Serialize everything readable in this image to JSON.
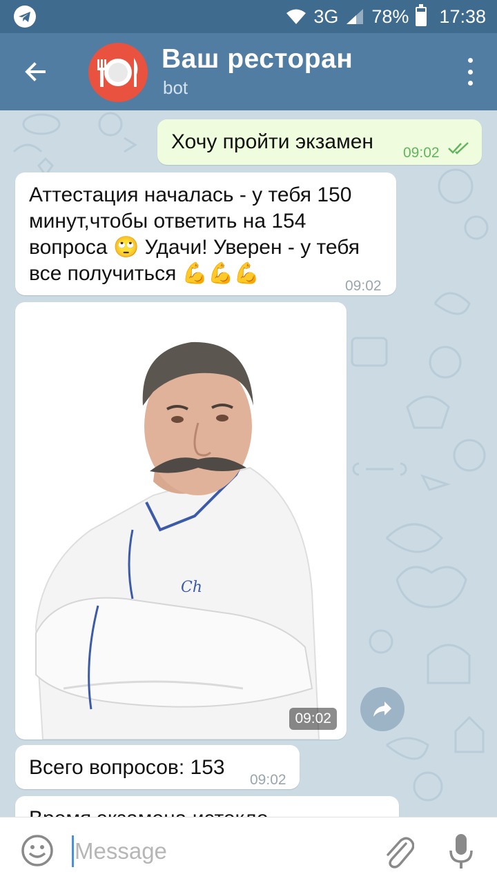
{
  "status_bar": {
    "network": "3G",
    "battery": "78%",
    "battery_level": 0.78,
    "time": "17:38",
    "icons": [
      "telegram-icon",
      "wifi-icon",
      "signal-icon",
      "battery-icon"
    ]
  },
  "header": {
    "title": "Ваш ресторан",
    "subtitle": "bot",
    "avatar_icon": "plate-cutlery-icon",
    "avatar_color": "#e8523f",
    "back_icon": "back-arrow-icon",
    "menu_icon": "more-vert-icon"
  },
  "messages": {
    "m1": {
      "text": "Хочу пройти экзамен",
      "time": "09:02",
      "status_icon": "double-check-icon"
    },
    "m2": {
      "line1": "Аттестация началась - у тебя 150",
      "line2": "минут,чтобы ответить на 154",
      "line3a": "вопроса",
      "emoji_rolling": "🙄",
      "line3b": "Удачи! Уверен - у тебя",
      "line4": "все получиться",
      "emoji_muscles": "💪💪💪",
      "time": "09:02"
    },
    "m3": {
      "type": "photo",
      "time": "09:02",
      "share_icon": "share-icon"
    },
    "m4": {
      "text": "Всего вопросов: 153",
      "time": "09:02"
    },
    "m5": {
      "text": "Время экзамена истекло"
    }
  },
  "input": {
    "placeholder": "Message",
    "emoji_icon": "emoji-icon",
    "attach_icon": "paperclip-icon",
    "mic_icon": "mic-icon"
  },
  "colors": {
    "statusbar": "#3f6b8f",
    "header": "#527da3",
    "chat_bg": "#cbdae3",
    "outgoing_bubble": "#effdde",
    "incoming_bubble": "#ffffff",
    "read_check": "#62b55d"
  }
}
